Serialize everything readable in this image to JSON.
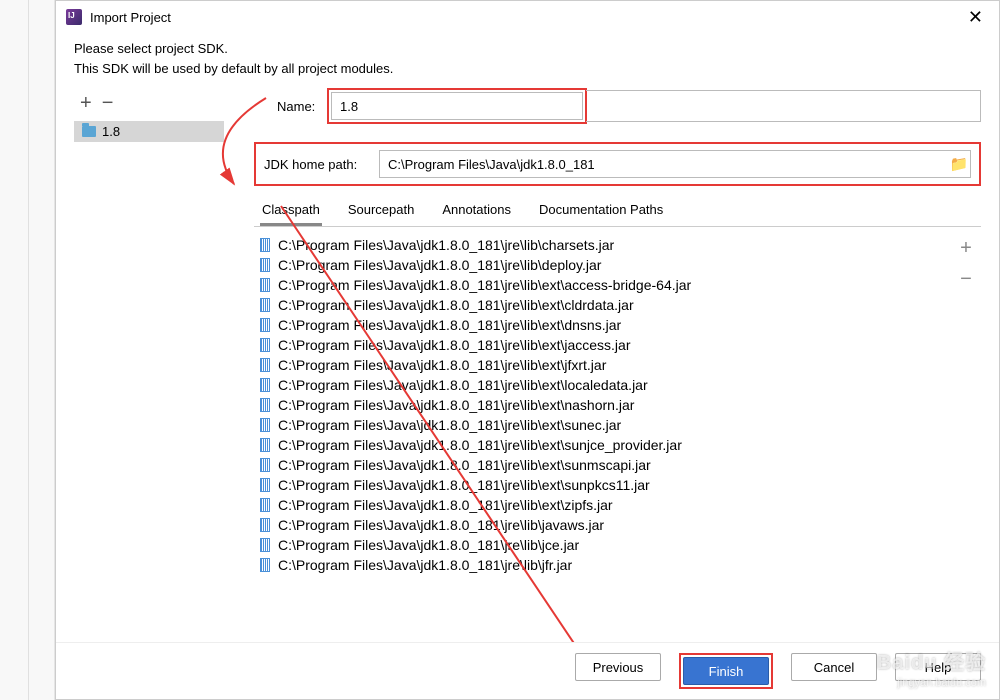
{
  "window": {
    "title": "Import Project"
  },
  "description": {
    "line1": "Please select project SDK.",
    "line2": "This SDK will be used by default by all project modules."
  },
  "toolbar": {
    "add": "+",
    "remove": "−"
  },
  "sdk_tree": {
    "item": "1.8"
  },
  "form": {
    "name_label": "Name:",
    "name_value": "1.8",
    "jdk_label": "JDK home path:",
    "jdk_value": "C:\\Program Files\\Java\\jdk1.8.0_181"
  },
  "tabs": {
    "classpath": "Classpath",
    "sourcepath": "Sourcepath",
    "annotations": "Annotations",
    "docs": "Documentation Paths"
  },
  "classpath": [
    "C:\\Program Files\\Java\\jdk1.8.0_181\\jre\\lib\\charsets.jar",
    "C:\\Program Files\\Java\\jdk1.8.0_181\\jre\\lib\\deploy.jar",
    "C:\\Program Files\\Java\\jdk1.8.0_181\\jre\\lib\\ext\\access-bridge-64.jar",
    "C:\\Program Files\\Java\\jdk1.8.0_181\\jre\\lib\\ext\\cldrdata.jar",
    "C:\\Program Files\\Java\\jdk1.8.0_181\\jre\\lib\\ext\\dnsns.jar",
    "C:\\Program Files\\Java\\jdk1.8.0_181\\jre\\lib\\ext\\jaccess.jar",
    "C:\\Program Files\\Java\\jdk1.8.0_181\\jre\\lib\\ext\\jfxrt.jar",
    "C:\\Program Files\\Java\\jdk1.8.0_181\\jre\\lib\\ext\\localedata.jar",
    "C:\\Program Files\\Java\\jdk1.8.0_181\\jre\\lib\\ext\\nashorn.jar",
    "C:\\Program Files\\Java\\jdk1.8.0_181\\jre\\lib\\ext\\sunec.jar",
    "C:\\Program Files\\Java\\jdk1.8.0_181\\jre\\lib\\ext\\sunjce_provider.jar",
    "C:\\Program Files\\Java\\jdk1.8.0_181\\jre\\lib\\ext\\sunmscapi.jar",
    "C:\\Program Files\\Java\\jdk1.8.0_181\\jre\\lib\\ext\\sunpkcs11.jar",
    "C:\\Program Files\\Java\\jdk1.8.0_181\\jre\\lib\\ext\\zipfs.jar",
    "C:\\Program Files\\Java\\jdk1.8.0_181\\jre\\lib\\javaws.jar",
    "C:\\Program Files\\Java\\jdk1.8.0_181\\jre\\lib\\jce.jar",
    "C:\\Program Files\\Java\\jdk1.8.0_181\\jre\\lib\\jfr.jar"
  ],
  "cp_side": {
    "add": "+",
    "remove": "−"
  },
  "buttons": {
    "previous": "Previous",
    "finish": "Finish",
    "cancel": "Cancel",
    "help": "Help"
  },
  "watermark": {
    "brand": "Baidu 经验",
    "url": "jingyan.baidu.com"
  }
}
